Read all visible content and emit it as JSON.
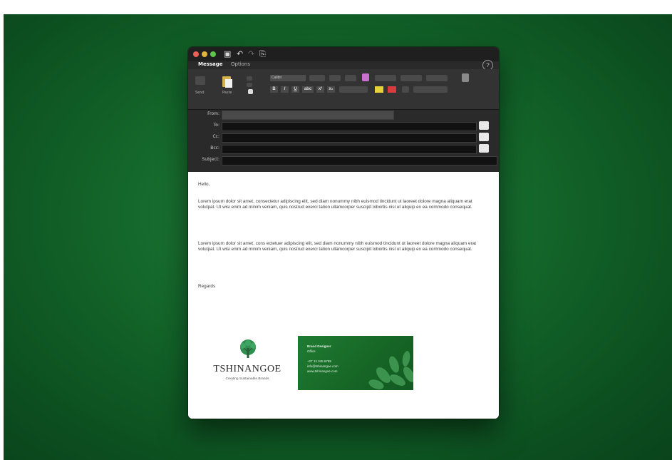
{
  "toolbar": {
    "tabs": [
      {
        "label": "Message"
      },
      {
        "label": "Options"
      }
    ]
  },
  "ribbon": {
    "font_name": "Calibri",
    "buttons": [
      "B",
      "I",
      "U",
      "abc",
      "x²",
      "x₂"
    ]
  },
  "fields": {
    "from_label": "From:",
    "to_label": "To:",
    "cc_label": "Cc:",
    "bcc_label": "Bcc:",
    "subject_label": "Subject:"
  },
  "email_body": {
    "greeting": "Hello,",
    "paragraph_1": "Lorem ipsum dolor sit amet, consectetur adipiscing elit, sed diam nonummy nibh euismod tincidunt ut laoreet dolore magna aliquam erat volutpat. Ut wisi enim ad minim veniam, quis nostrud exerci tation ullamcorper suscipit lobortis nisl ut aliquip ex ea commodo consequat.",
    "paragraph_2": "Lorem ipsum dolor sit amet, cons ectetuer adipiscing elit, sed diam nonummy nibh euismod tincidunt ut laoreet dolore magna aliquam erat volutpat. Ut wisi enim ad minim veniam, quis nostrud exerci tation ullamcorper suscipit lobortis nisl ut aliquip ex ea commodo consequat.",
    "regards": "Regards"
  },
  "signature": {
    "logo_text": "TSHINANGOE",
    "logo_tagline": "Creating Sustainable Brands",
    "card_lines": [
      "Brand Designer",
      "Office",
      "+27 12 345 6789",
      "info@tshinangoe.com",
      "www.tshinangoe.com"
    ]
  },
  "colors": {
    "background": "#13652a",
    "chrome": "#2a2a2a",
    "accent": "#1f7c31"
  }
}
